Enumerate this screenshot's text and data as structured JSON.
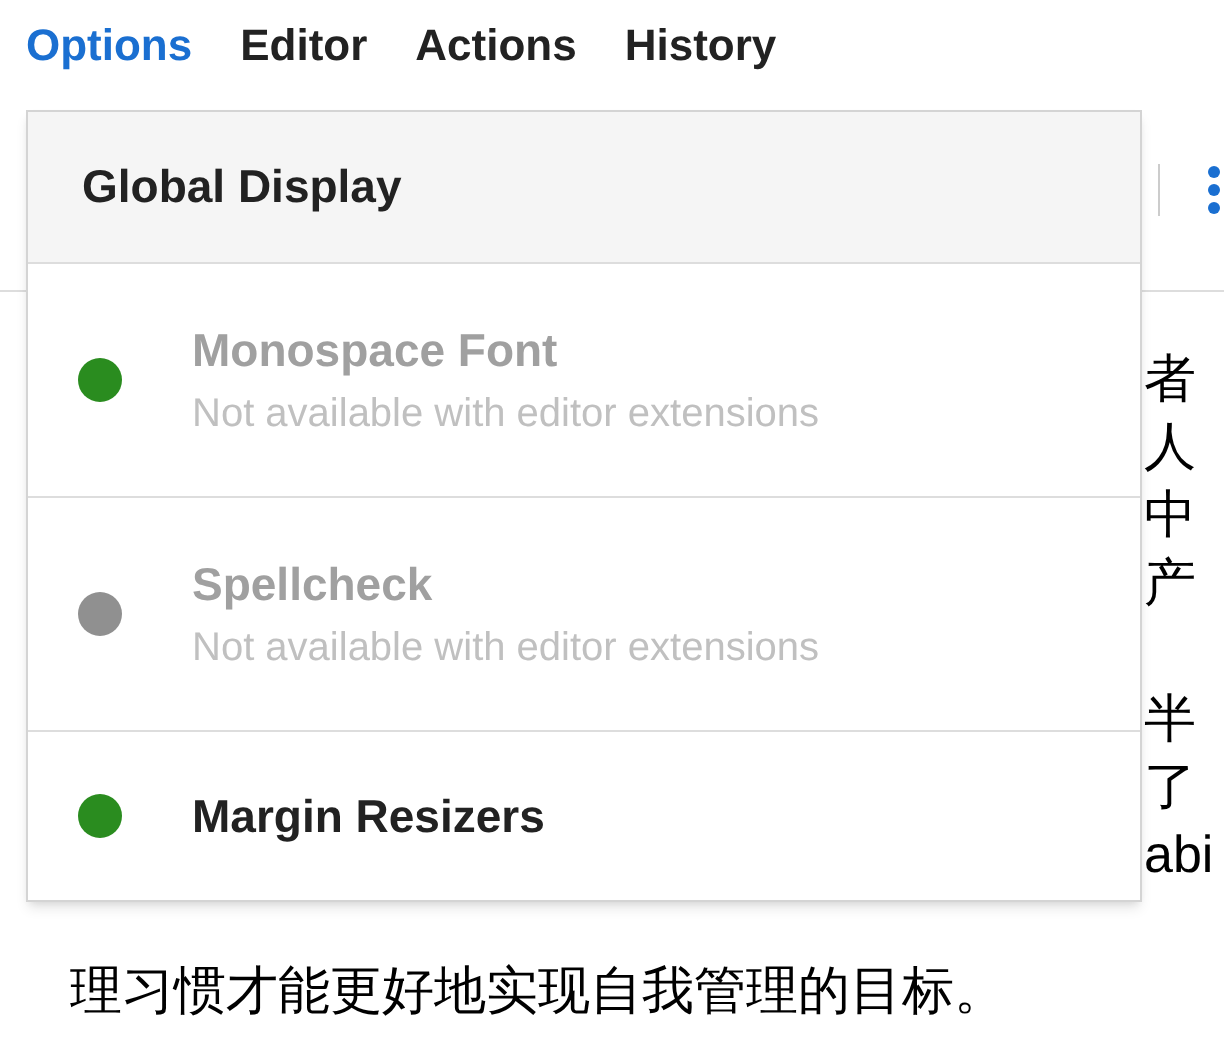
{
  "menu_bar": [
    {
      "label": "Options",
      "selected": true
    },
    {
      "label": "Editor",
      "selected": false
    },
    {
      "label": "Actions",
      "selected": false
    },
    {
      "label": "History",
      "selected": false
    }
  ],
  "editor_paragraphs": [
    {
      "lines": [
        "者",
        "人",
        "中",
        "产"
      ]
    },
    {
      "lines": [
        "半",
        "了",
        "abi"
      ]
    }
  ],
  "editor_last_line": "理习惯才能更好地实现自我管理的目标。",
  "dropdown": {
    "title": "Global Display",
    "items": [
      {
        "label": "Monospace Font",
        "description": "Not available with editor extensions",
        "disabled": true,
        "color": "#2a8c1f"
      },
      {
        "label": "Spellcheck",
        "description": "Not available with editor extensions",
        "disabled": true,
        "color": "#909090"
      },
      {
        "label": "Margin Resizers",
        "disabled": false,
        "color": "#2a8c1f"
      }
    ]
  }
}
